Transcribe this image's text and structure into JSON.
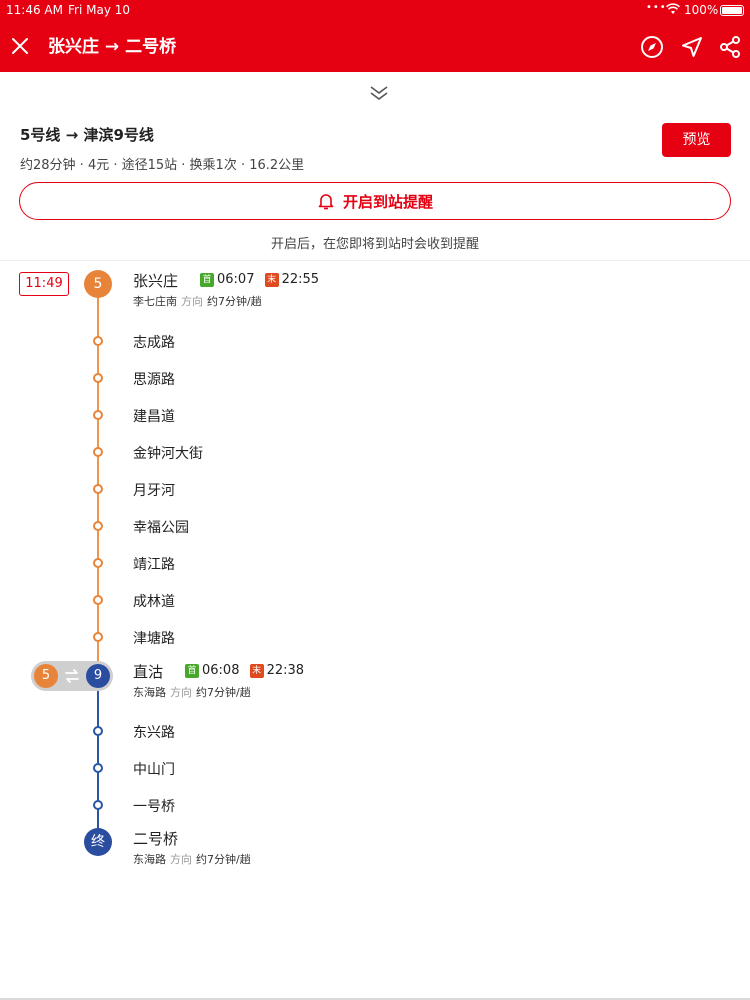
{
  "status": {
    "time": "11:46 AM",
    "date": "Fri May 10",
    "dots": "•••",
    "battery": "100%"
  },
  "header": {
    "title": "张兴庄 → 二号桥"
  },
  "summary": {
    "title": "5号线 → 津滨9号线",
    "meta": "约28分钟 · 4元 · 途径15站 · 换乘1次 · 16.2公里",
    "preview_label": "预览",
    "alert_label": "开启到站提醒",
    "alert_hint": "开启后，在您即将到站时会收到提醒"
  },
  "timeline": {
    "depart_time": "11:49",
    "line1": {
      "number": "5",
      "color": "#e8843a"
    },
    "line2": {
      "number": "9",
      "color": "#2a4da0"
    },
    "start": {
      "name": "张兴庄",
      "first_badge": "首",
      "first_time": "06:07",
      "last_badge": "末",
      "last_time": "22:55",
      "toward": "李七庄南",
      "dir_label": "方向",
      "interval": "约7分钟/趟"
    },
    "stops1": [
      "志成路",
      "思源路",
      "建昌道",
      "金钟河大街",
      "月牙河",
      "幸福公园",
      "靖江路",
      "成林道",
      "津塘路"
    ],
    "transfer": {
      "name": "直沽",
      "from": "5",
      "to": "9",
      "first_badge": "首",
      "first_time": "06:08",
      "last_badge": "末",
      "last_time": "22:38",
      "toward": "东海路",
      "dir_label": "方向",
      "interval": "约7分钟/趟"
    },
    "stops2": [
      "东兴路",
      "中山门",
      "一号桥"
    ],
    "end": {
      "name": "二号桥",
      "end_badge": "终",
      "toward": "东海路",
      "dir_label": "方向",
      "interval": "约7分钟/趟"
    }
  }
}
